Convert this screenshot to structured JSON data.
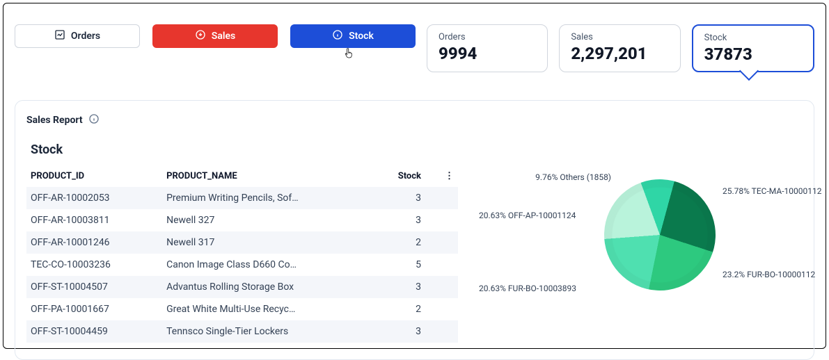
{
  "tabs": {
    "orders": "Orders",
    "sales": "Sales",
    "stock": "Stock"
  },
  "cards": {
    "orders": {
      "label": "Orders",
      "value": "9994"
    },
    "sales": {
      "label": "Sales",
      "value": "2,297,201"
    },
    "stock": {
      "label": "Stock",
      "value": "37873"
    }
  },
  "report": {
    "title": "Sales Report",
    "section": "Stock",
    "columns": {
      "id": "PRODUCT_ID",
      "name": "PRODUCT_NAME",
      "stock": "Stock"
    },
    "rows": [
      {
        "id": "OFF-AR-10002053",
        "name": "Premium Writing Pencils, Sof…",
        "stock": 3
      },
      {
        "id": "OFF-AR-10003811",
        "name": "Newell 327",
        "stock": 3
      },
      {
        "id": "OFF-AR-10001246",
        "name": "Newell 317",
        "stock": 2
      },
      {
        "id": "TEC-CO-10003236",
        "name": "Canon Image Class D660 Co…",
        "stock": 5
      },
      {
        "id": "OFF-ST-10004507",
        "name": "Advantus Rolling Storage Box",
        "stock": 3
      },
      {
        "id": "OFF-PA-10001667",
        "name": "Great White Multi-Use Recyc…",
        "stock": 2
      },
      {
        "id": "OFF-ST-10004459",
        "name": "Tennsco Single-Tier Lockers",
        "stock": 3
      }
    ]
  },
  "chart_data": {
    "type": "pie",
    "title": "",
    "series": [
      {
        "name": "Others (1858)",
        "pct": 9.76,
        "label": "9.76% Others (1858)",
        "color": "#2fd6a6"
      },
      {
        "name": "TEC-MA-10000112",
        "pct": 25.78,
        "label": "25.78% TEC-MA-10000112",
        "color": "#0a7a4d"
      },
      {
        "name": "FUR-BO-10000112",
        "pct": 23.2,
        "label": "23.2% FUR-BO-10000112",
        "color": "#2dc97f"
      },
      {
        "name": "FUR-BO-10003893",
        "pct": 20.63,
        "label": "20.63% FUR-BO-10003893",
        "color": "#4fe0b0"
      },
      {
        "name": "OFF-AP-10001124",
        "pct": 20.63,
        "label": "20.63% OFF-AP-10001124",
        "color": "#b9f3db"
      }
    ]
  }
}
